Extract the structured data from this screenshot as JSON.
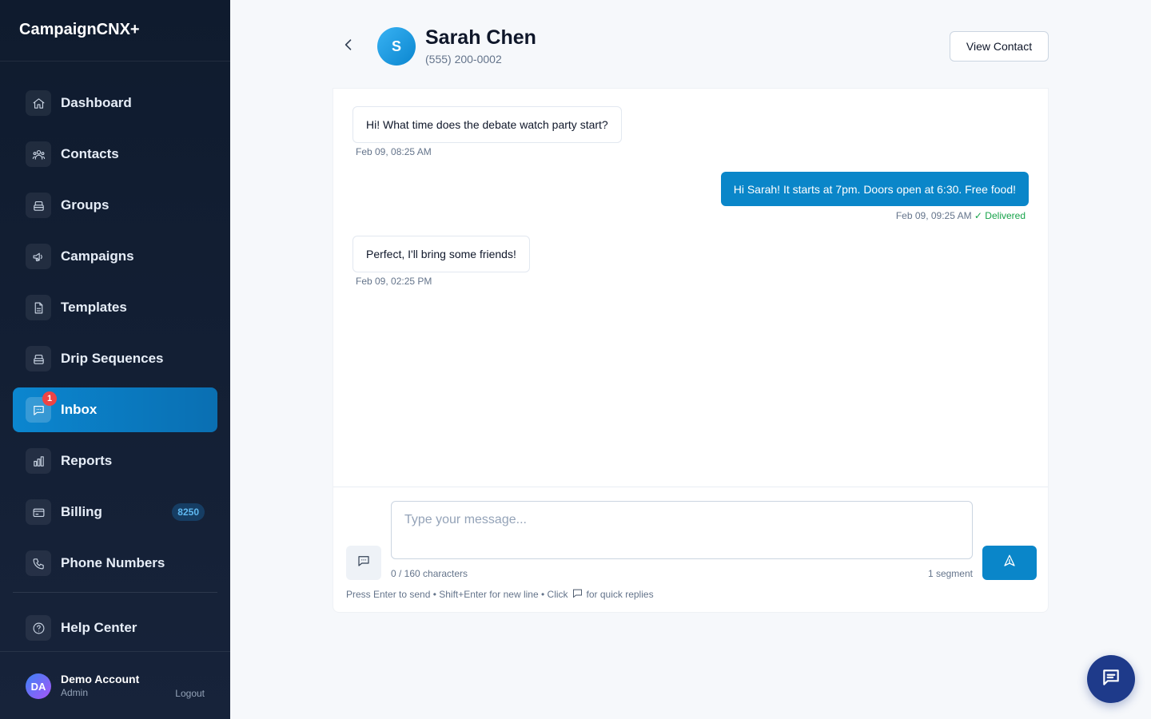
{
  "app": {
    "name": "CampaignCNX+"
  },
  "sidebar": {
    "items": [
      {
        "label": "Dashboard",
        "icon": "home-icon"
      },
      {
        "label": "Contacts",
        "icon": "users-icon"
      },
      {
        "label": "Groups",
        "icon": "layers-icon"
      },
      {
        "label": "Campaigns",
        "icon": "megaphone-icon"
      },
      {
        "label": "Templates",
        "icon": "document-icon"
      },
      {
        "label": "Drip Sequences",
        "icon": "layers-icon"
      },
      {
        "label": "Inbox",
        "icon": "chat-icon",
        "active": true,
        "badge": "1"
      },
      {
        "label": "Reports",
        "icon": "bar-chart-icon"
      },
      {
        "label": "Billing",
        "icon": "credit-card-icon",
        "pill": "8250"
      },
      {
        "label": "Phone Numbers",
        "icon": "phone-icon"
      }
    ],
    "help": {
      "label": "Help Center",
      "icon": "help-circle-icon"
    },
    "account": {
      "initials": "DA",
      "name": "Demo Account",
      "role": "Admin",
      "logout": "Logout"
    }
  },
  "conversation": {
    "back_icon": "chevron-left-icon",
    "contact_initial": "S",
    "contact_name": "Sarah Chen",
    "contact_phone": "(555) 200-0002",
    "view_contact_label": "View Contact",
    "messages": [
      {
        "direction": "incoming",
        "text": "Hi! What time does the debate watch party start?",
        "time": "Feb 09, 08:25 AM"
      },
      {
        "direction": "outgoing",
        "text": "Hi Sarah! It starts at 7pm. Doors open at 6:30. Free food!",
        "time": "Feb 09, 09:25 AM",
        "status": "✓ Delivered"
      },
      {
        "direction": "incoming",
        "text": "Perfect, I'll bring some friends!",
        "time": "Feb 09, 02:25 PM"
      }
    ]
  },
  "composer": {
    "placeholder": "Type your message...",
    "char_count": "0 / 160 characters",
    "segment": "1 segment",
    "hint_before": "Press Enter to send • Shift+Enter for new line • Click",
    "hint_after": "for quick replies"
  },
  "colors": {
    "accent": "#0a86c9",
    "sidebar_bg": "#0f1b2e",
    "badge_red": "#ef4444",
    "delivered_green": "#16a34a",
    "fab": "#1e3a8a"
  }
}
